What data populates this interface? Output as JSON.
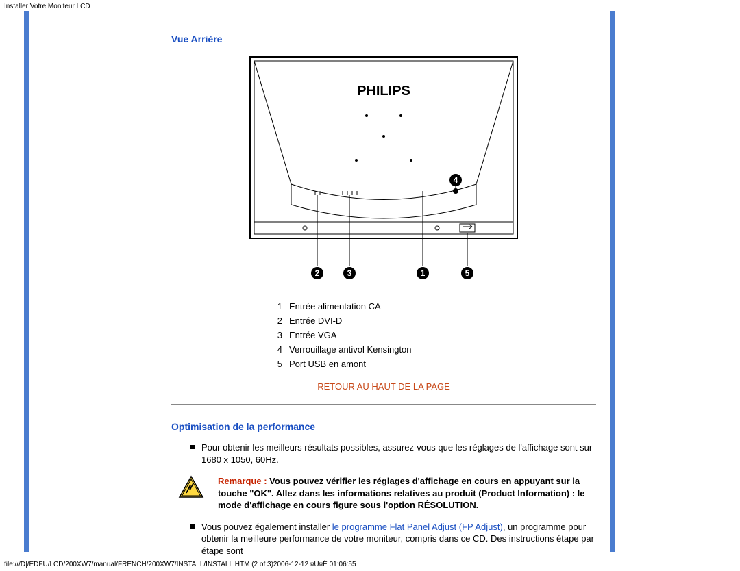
{
  "header_path": "Installer Votre Moniteur LCD",
  "section1_title": "Vue Arrière",
  "brand": "PHILIPS",
  "markers": [
    "1",
    "2",
    "3",
    "4",
    "5"
  ],
  "legend": [
    {
      "n": "1",
      "t": "Entrée alimentation CA"
    },
    {
      "n": "2",
      "t": "Entrée DVI-D"
    },
    {
      "n": "3",
      "t": "Entrée VGA"
    },
    {
      "n": "4",
      "t": "Verrouillage antivol Kensington"
    },
    {
      "n": "5",
      "t": "Port USB en amont"
    }
  ],
  "back_to_top": "RETOUR AU HAUT DE LA PAGE",
  "section2_title": "Optimisation de la performance",
  "bullet1": "Pour obtenir les meilleurs résultats possibles, assurez-vous que les réglages de l'affichage sont sur 1680 x 1050, 60Hz.",
  "remark_lead": "Remarque :",
  "remark_body": " Vous pouvez vérifier les réglages d'affichage en cours en appuyant sur la touche \"OK\". Allez dans les informations relatives au produit (Product Information) : le mode d'affichage en cours figure sous l'option RÉSOLUTION",
  "remark_tail": ".",
  "bullet2_pre": "Vous pouvez également installer ",
  "bullet2_link": "le programme Flat Panel Adjust (FP Adjust)",
  "bullet2_post": ", un programme pour obtenir la meilleure performance de votre moniteur, compris dans ce CD. Des instructions étape par étape sont",
  "footer_path": "file:///D|/EDFU/LCD/200XW7/manual/FRENCH/200XW7/INSTALL/INSTALL.HTM (2 of 3)2006-12-12 ¤U¤È 01:06:55"
}
